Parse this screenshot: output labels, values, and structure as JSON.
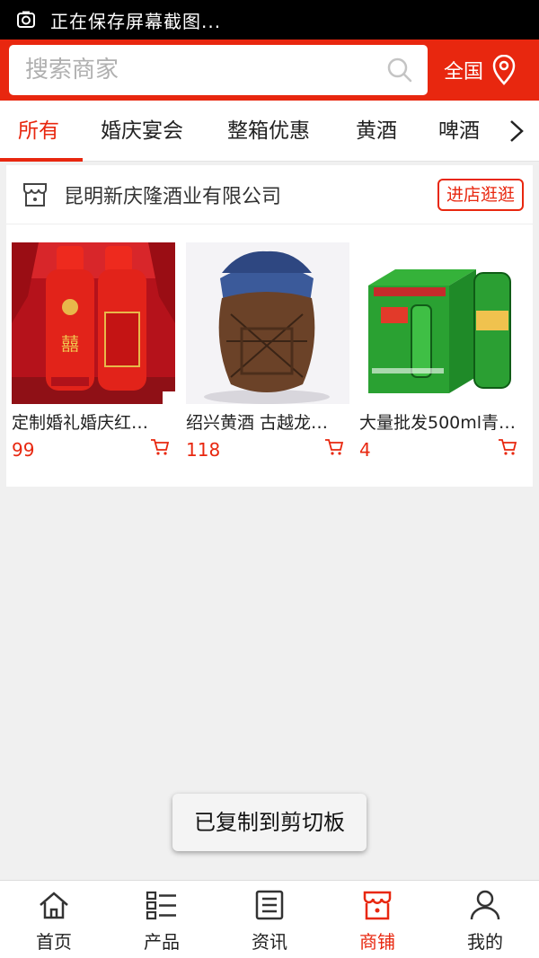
{
  "status_bar": {
    "text": "正在保存屏幕截图..."
  },
  "header": {
    "search_placeholder": "搜索商家",
    "region_label": "全国"
  },
  "tabs": [
    {
      "label": "所有",
      "active": true
    },
    {
      "label": "婚庆宴会"
    },
    {
      "label": "整箱优惠"
    },
    {
      "label": "黄酒"
    },
    {
      "label": "啤酒"
    }
  ],
  "shop": {
    "name": "昆明新庆隆酒业有限公司",
    "visit_label": "进店逛逛",
    "products": [
      {
        "name": "定制婚礼婚庆红…",
        "price": "99",
        "image": "red-wedding-liquor-bottles"
      },
      {
        "name": "绍兴黄酒 古越龙…",
        "price": "118",
        "image": "clay-yellow-wine-jar"
      },
      {
        "name": "大量批发500ml青…",
        "price": "4",
        "image": "green-beer-cans-box"
      }
    ]
  },
  "toast": "已复制到剪切板",
  "bottom_nav": [
    {
      "label": "首页",
      "icon": "home-icon"
    },
    {
      "label": "产品",
      "icon": "list-icon"
    },
    {
      "label": "资讯",
      "icon": "news-icon"
    },
    {
      "label": "商铺",
      "icon": "shop-icon",
      "active": true
    },
    {
      "label": "我的",
      "icon": "user-icon"
    }
  ],
  "colors": {
    "brand": "#e8270f",
    "background": "#f0f0f0"
  }
}
